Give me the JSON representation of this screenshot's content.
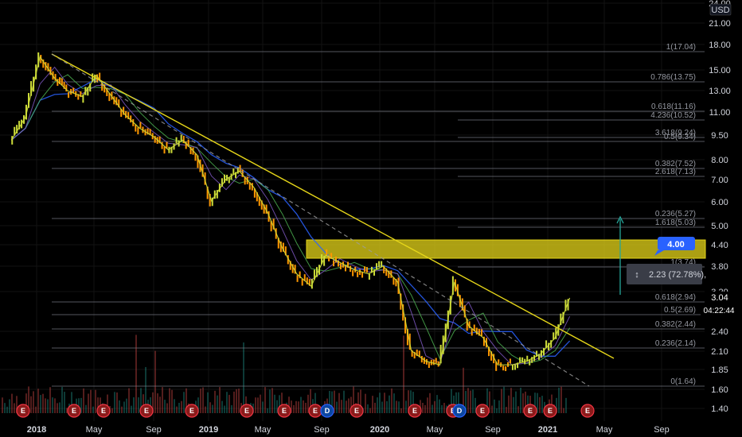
{
  "currency": "USD",
  "price_axis": {
    "ticks": [
      "24.00",
      "21.00",
      "18.00",
      "15.00",
      "13.00",
      "11.00",
      "9.50",
      "8.00",
      "7.00",
      "6.00",
      "5.00",
      "4.40",
      "3.80",
      "3.20",
      "2.40",
      "2.10",
      "1.85",
      "1.60",
      "1.40"
    ],
    "current_price": "3.04",
    "countdown": "04:22:44",
    "current_color": "#26a69a"
  },
  "time_axis": {
    "labels": [
      "2018",
      "May",
      "Sep",
      "2019",
      "May",
      "Sep",
      "2020",
      "May",
      "Sep",
      "2021",
      "May",
      "Sep"
    ]
  },
  "fib_levels": [
    {
      "label": "1(17.04)"
    },
    {
      "label": "0.786(13.75)"
    },
    {
      "label": "0.618(11.16)"
    },
    {
      "label": "4.236(10.52)"
    },
    {
      "label": "3.618(9.24)"
    },
    {
      "label": "0.5(9.34)"
    },
    {
      "label": "0.382(7.52)"
    },
    {
      "label": "2.618(7.13)"
    },
    {
      "label": "0.236(5.27)"
    },
    {
      "label": "1.618(5.03)"
    },
    {
      "label": "1(3.74)"
    },
    {
      "label": "0.618(2.94)"
    },
    {
      "label": "0.5(2.69)"
    },
    {
      "label": "0.382(2.44)"
    },
    {
      "label": "0.236(2.14)"
    },
    {
      "label": "0(1.64)"
    }
  ],
  "annotations": {
    "target_label": "4.00",
    "measure_label": "2.23 (72.78%),"
  },
  "earnings_marker": "E",
  "dividend_marker": "D",
  "colors": {
    "trendline": "#e6d619",
    "zone_fill": "#e6d619",
    "target_box": "#2962ff",
    "arrow": "#26a69a",
    "ma_blue": "#2962ff",
    "ma_green": "#4caf50",
    "candle_up": "#cddc39",
    "candle_down": "#ff9800"
  },
  "chart_data": {
    "type": "line",
    "title": "",
    "xlabel": "",
    "ylabel": "",
    "y_scale": "log",
    "ylim": [
      1.3,
      24
    ],
    "x": [
      "2017-11",
      "2017-12",
      "2018-01",
      "2018-02",
      "2018-03",
      "2018-04",
      "2018-05",
      "2018-06",
      "2018-07",
      "2018-08",
      "2018-09",
      "2018-10",
      "2018-11",
      "2018-12",
      "2019-01",
      "2019-02",
      "2019-03",
      "2019-04",
      "2019-05",
      "2019-06",
      "2019-07",
      "2019-08",
      "2019-09",
      "2019-10",
      "2019-11",
      "2019-12",
      "2020-01",
      "2020-02",
      "2020-03",
      "2020-04",
      "2020-05",
      "2020-06",
      "2020-07",
      "2020-08",
      "2020-09",
      "2020-10",
      "2020-11",
      "2020-12",
      "2021-01",
      "2021-02"
    ],
    "series": [
      {
        "values": [
          9.2,
          10.8,
          16.5,
          14.2,
          13.0,
          12.5,
          14.5,
          12.6,
          11.0,
          10.0,
          9.4,
          8.6,
          9.2,
          8.3,
          6.0,
          7.0,
          7.4,
          6.6,
          5.5,
          4.3,
          3.6,
          3.3,
          4.1,
          3.9,
          3.7,
          3.6,
          3.8,
          3.4,
          2.1,
          1.95,
          1.9,
          3.4,
          2.5,
          2.3,
          1.9,
          1.9,
          1.95,
          2.05,
          2.3,
          3.04
        ]
      }
    ]
  }
}
